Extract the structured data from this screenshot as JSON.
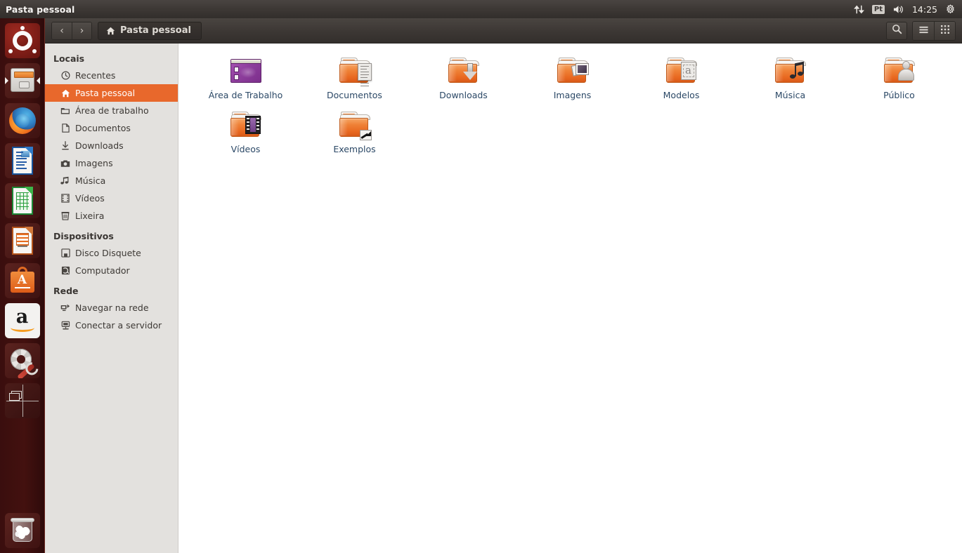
{
  "panel": {
    "title": "Pasta pessoal",
    "tray": {
      "network_icon": "network-updown-icon",
      "keyboard_layout": "Pt",
      "volume_icon": "volume-icon",
      "clock": "14:25",
      "session_icon": "gear-session-icon"
    }
  },
  "launcher": {
    "items": [
      {
        "name": "ubuntu-dash",
        "label": "Ubuntu Dash"
      },
      {
        "name": "files",
        "label": "Arquivos",
        "running": true
      },
      {
        "name": "firefox",
        "label": "Firefox"
      },
      {
        "name": "libreoffice-writer",
        "label": "LibreOffice Writer"
      },
      {
        "name": "libreoffice-calc",
        "label": "LibreOffice Calc"
      },
      {
        "name": "libreoffice-impress",
        "label": "LibreOffice Impress"
      },
      {
        "name": "software-center",
        "label": "Central de Programas Ubuntu"
      },
      {
        "name": "amazon",
        "label": "Amazon"
      },
      {
        "name": "system-settings",
        "label": "Configurações do sistema"
      },
      {
        "name": "workspace-switcher",
        "label": "Alternador de espaços de trabalho"
      }
    ],
    "trash": {
      "name": "trash",
      "label": "Lixeira"
    }
  },
  "toolbar": {
    "back_label": "‹",
    "forward_label": "›",
    "breadcrumb": "Pasta pessoal",
    "search_label": "Pesquisar",
    "menu_label": "Menu",
    "view_options_label": "Opções de visualização"
  },
  "sidebar": {
    "sections": [
      {
        "heading": "Locais",
        "items": [
          {
            "label": "Recentes",
            "icon": "clock-icon",
            "selected": false
          },
          {
            "label": "Pasta pessoal",
            "icon": "home-icon",
            "selected": true
          },
          {
            "label": "Área de trabalho",
            "icon": "desktop-folder-icon",
            "selected": false
          },
          {
            "label": "Documentos",
            "icon": "document-icon",
            "selected": false
          },
          {
            "label": "Downloads",
            "icon": "download-icon",
            "selected": false
          },
          {
            "label": "Imagens",
            "icon": "camera-icon",
            "selected": false
          },
          {
            "label": "Música",
            "icon": "music-note-icon",
            "selected": false
          },
          {
            "label": "Vídeos",
            "icon": "film-icon",
            "selected": false
          },
          {
            "label": "Lixeira",
            "icon": "trash-icon",
            "selected": false
          }
        ]
      },
      {
        "heading": "Dispositivos",
        "items": [
          {
            "label": "Disco Disquete",
            "icon": "floppy-icon",
            "selected": false
          },
          {
            "label": "Computador",
            "icon": "computer-icon",
            "selected": false
          }
        ]
      },
      {
        "heading": "Rede",
        "items": [
          {
            "label": "Navegar na rede",
            "icon": "network-browse-icon",
            "selected": false
          },
          {
            "label": "Conectar a servidor",
            "icon": "server-connect-icon",
            "selected": false
          }
        ]
      }
    ]
  },
  "files": {
    "items": [
      {
        "label": "Área de Trabalho",
        "kind": "desktop"
      },
      {
        "label": "Documentos",
        "kind": "documents"
      },
      {
        "label": "Downloads",
        "kind": "downloads"
      },
      {
        "label": "Imagens",
        "kind": "pictures"
      },
      {
        "label": "Modelos",
        "kind": "templates"
      },
      {
        "label": "Música",
        "kind": "music"
      },
      {
        "label": "Público",
        "kind": "public"
      },
      {
        "label": "Vídeos",
        "kind": "videos"
      },
      {
        "label": "Exemplos",
        "kind": "link"
      }
    ]
  },
  "colors": {
    "accent_orange": "#e8682c",
    "panel_dark": "#3d3835",
    "launcher_maroon": "#3a0e0e",
    "sidebar_grey": "#e3e1de",
    "label_blue": "#2b4866"
  }
}
